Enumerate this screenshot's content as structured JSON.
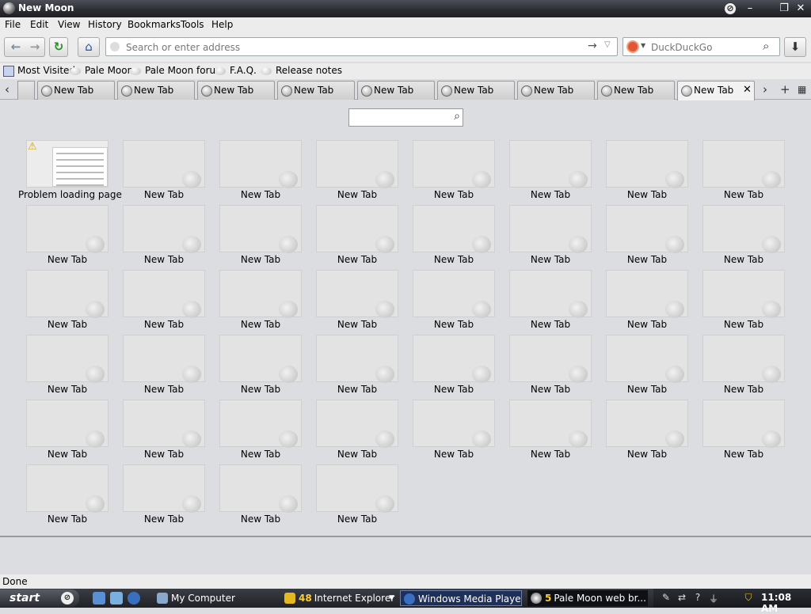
{
  "window": {
    "title": "New Moon"
  },
  "menu": [
    "File",
    "Edit",
    "View",
    "History",
    "Bookmarks",
    "Tools",
    "Help"
  ],
  "nav": {
    "back_glyph": "←",
    "forward_glyph": "→",
    "reload_glyph": "↻",
    "home_glyph": "⌂",
    "url_placeholder": "Search or enter address",
    "go_glyph": "→",
    "dropdown_glyph": "▽",
    "search_placeholder": "DuckDuckGo",
    "search_glyph": "⌕",
    "download_glyph": "⬇"
  },
  "bookmarks": [
    "Most Visited",
    "Pale Moon",
    "Pale Moon forum",
    "F.A.Q.",
    "Release notes"
  ],
  "tabs": {
    "labels": [
      "New Tab",
      "New Tab",
      "New Tab",
      "New Tab",
      "New Tab",
      "New Tab",
      "New Tab",
      "New Tab",
      "New Tab"
    ],
    "active_index": 8,
    "close_glyph": "✕",
    "left_glyph": "‹",
    "right_glyph": "›",
    "new_glyph": "+",
    "list_glyph": "▦"
  },
  "grid": {
    "search_glyph": "⌕",
    "items": [
      "Problem loading page",
      "New Tab",
      "New Tab",
      "New Tab",
      "New Tab",
      "New Tab",
      "New Tab",
      "New Tab",
      "New Tab",
      "New Tab",
      "New Tab",
      "New Tab",
      "New Tab",
      "New Tab",
      "New Tab",
      "New Tab",
      "New Tab",
      "New Tab",
      "New Tab",
      "New Tab",
      "New Tab",
      "New Tab",
      "New Tab",
      "New Tab",
      "New Tab",
      "New Tab",
      "New Tab",
      "New Tab",
      "New Tab",
      "New Tab",
      "New Tab",
      "New Tab",
      "New Tab",
      "New Tab",
      "New Tab",
      "New Tab",
      "New Tab",
      "New Tab",
      "New Tab",
      "New Tab",
      "New Tab",
      "New Tab",
      "New Tab",
      "New Tab"
    ]
  },
  "status": {
    "text": "Done"
  },
  "taskbar": {
    "start": "start",
    "tasks": [
      {
        "count": "",
        "label": "My Computer"
      },
      {
        "count": "48",
        "label": "Internet Explorer"
      },
      {
        "count": "",
        "label": "Windows Media Player"
      },
      {
        "count": "5",
        "label": "Pale Moon web br..."
      }
    ],
    "clock": "11:08 AM"
  },
  "colors": {
    "titlebar": "#2a2c32",
    "chrome": "#ececec",
    "content": "#dcdde0",
    "taskbar": "#1f2126"
  }
}
